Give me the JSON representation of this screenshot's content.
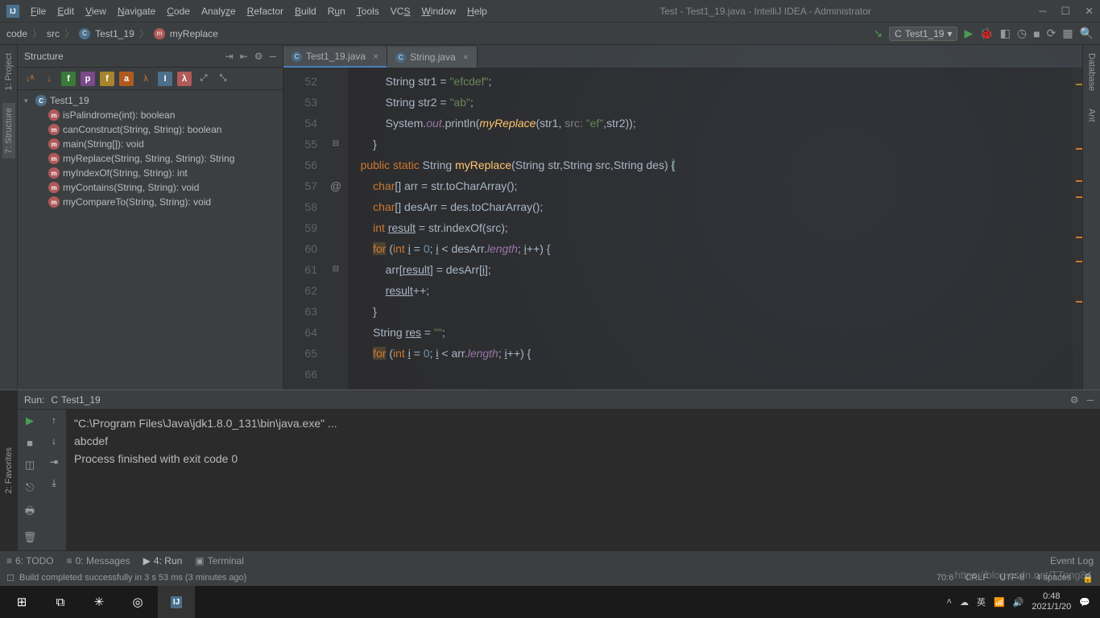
{
  "titlebar": {
    "title": "Test - Test1_19.java - IntelliJ IDEA - Administrator"
  },
  "menu": [
    "File",
    "Edit",
    "View",
    "Navigate",
    "Code",
    "Analyze",
    "Refactor",
    "Build",
    "Run",
    "Tools",
    "VCS",
    "Window",
    "Help"
  ],
  "breadcrumbs": {
    "p1": "code",
    "p2": "src",
    "p3": "Test1_19",
    "p4": "myReplace"
  },
  "runconfig": "Test1_19",
  "structure": {
    "title": "Structure",
    "class": "Test1_19",
    "methods": [
      "isPalindrome(int): boolean",
      "canConstruct(String, String): boolean",
      "main(String[]): void",
      "myReplace(String, String, String): String",
      "myIndexOf(String, String): int",
      "myContains(String, String): void",
      "myCompareTo(String, String): void"
    ]
  },
  "tabs": [
    {
      "name": "Test1_19.java",
      "active": true
    },
    {
      "name": "String.java",
      "active": false
    }
  ],
  "lines": [
    "52",
    "53",
    "54",
    "55",
    "56",
    "57",
    "58",
    "59",
    "60",
    "61",
    "62",
    "63",
    "64",
    "65",
    "66"
  ],
  "code": {
    "l52a": "            String str1 = ",
    "l52b": "\"efcdef\"",
    "l52c": ";",
    "l53a": "            String str2 = ",
    "l53b": "\"ab\"",
    "l53c": ";",
    "l54a": "            System.",
    "l54out": "out",
    "l54b": ".println(",
    "l54fn": "myReplace",
    "l54c": "(str1, ",
    "l54hint": "src: ",
    "l54d": "\"ef\"",
    "l54e": ",str2));",
    "l55": "        }",
    "l56": "",
    "l57a": "    ",
    "l57pub": "public static",
    "l57b": " String ",
    "l57fn": "myReplace",
    "l57c": "(String str,String src,String des) ",
    "l57br": "{",
    "l58a": "        ",
    "l58kw": "char",
    "l58b": "[] arr = str.toCharArray();",
    "l59a": "        ",
    "l59kw": "char",
    "l59b": "[] desArr = des.toCharArray();",
    "l60a": "        ",
    "l60kw": "int",
    "l60b": " ",
    "l60v": "result",
    "l60c": " = str.indexOf(src);",
    "l61a": "        ",
    "l61kw": "for",
    "l61b": " (",
    "l61kw2": "int",
    "l61c": " ",
    "l61v": "i",
    "l61d": " = ",
    "l61n": "0",
    "l61e": "; ",
    "l61v2": "i",
    "l61f": " < desArr.",
    "l61len": "length",
    "l61g": "; ",
    "l61v3": "i",
    "l61h": "++) {",
    "l62a": "            arr[",
    "l62v": "result",
    "l62b": "] = desArr[",
    "l62v2": "i",
    "l62c": "];",
    "l63a": "            ",
    "l63v": "result",
    "l63b": "++;",
    "l64": "        }",
    "l65a": "        String ",
    "l65v": "res",
    "l65b": " = ",
    "l65s": "\"\"",
    "l65c": ";",
    "l66a": "        ",
    "l66kw": "for",
    "l66b": " (",
    "l66kw2": "int",
    "l66c": " ",
    "l66v": "i",
    "l66d": " = ",
    "l66n": "0",
    "l66e": "; ",
    "l66v2": "i",
    "l66f": " < arr.",
    "l66len": "length",
    "l66g": "; ",
    "l66v3": "i",
    "l66h": "++) {"
  },
  "run": {
    "label": "Run:",
    "tab": "Test1_19",
    "out1": "\"C:\\Program Files\\Java\\jdk1.8.0_131\\bin\\java.exe\" ...",
    "out2": "abcdef",
    "out3": "",
    "out4": "Process finished with exit code 0"
  },
  "bottombar": {
    "todo": "6: TODO",
    "messages": "0: Messages",
    "run": "4: Run",
    "terminal": "Terminal",
    "eventlog": "Event Log"
  },
  "status": {
    "build": "Build completed successfully in 3 s 53 ms (3 minutes ago)",
    "pos": "70:6",
    "enc": "CRLF",
    "charset": "UTF-8",
    "spaces": "4 spaces"
  },
  "leftstrip": {
    "project": "1: Project",
    "structure": "7: Structure",
    "favorites": "2: Favorites"
  },
  "rightstrip": {
    "database": "Database",
    "ant": "Ant"
  },
  "taskbar": {
    "time": "0:48",
    "date": "2021/1/20"
  },
  "watermark": "https://blog.csdn.net/TTong84"
}
